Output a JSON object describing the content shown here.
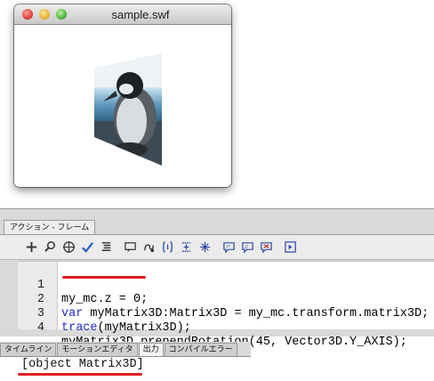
{
  "window": {
    "title": "sample.swf"
  },
  "actions_panel": {
    "tab_label": "アクション - フレーム",
    "toolbar_icons": [
      "add-action-icon",
      "find-icon",
      "target-icon",
      "check-syntax-icon",
      "auto-format-icon",
      "code-hint-icon",
      "debug-options-icon",
      "collapse-between-braces-icon",
      "collapse-selection-icon",
      "expand-all-icon",
      "apply-block-comment-icon",
      "apply-line-comment-icon",
      "remove-comment-icon",
      "show-hide-toolbox-icon"
    ],
    "code_lines": [
      {
        "num": "1",
        "text": "my_mc.z = 0;"
      },
      {
        "num": "2",
        "prefix": "var",
        "text": " myMatrix3D:Matrix3D = my_mc.transform.matrix3D;"
      },
      {
        "num": "3",
        "prefix": "trace",
        "text": "(myMatrix3D);"
      },
      {
        "num": "4",
        "text": "myMatrix3D.prependRotation(45, Vector3D.Y_AXIS);"
      }
    ]
  },
  "output_tabs": [
    {
      "label": "タイムライン",
      "active": false
    },
    {
      "label": "モーションエディタ",
      "active": false
    },
    {
      "label": "出力",
      "active": true
    },
    {
      "label": "コンパイルエラー",
      "active": false
    }
  ],
  "output": {
    "text": "[object Matrix3D]"
  },
  "colors": {
    "keyword": "#1d2bd1",
    "highlight": "#e02020"
  }
}
